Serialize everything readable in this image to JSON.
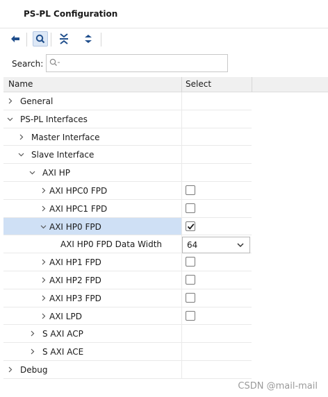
{
  "window": {
    "title": "PS-PL Configuration"
  },
  "toolbar": {
    "buttons": [
      {
        "icon": "back-arrow-icon"
      },
      {
        "icon": "search-icon"
      },
      {
        "icon": "collapse-all-icon"
      },
      {
        "icon": "expand-all-icon"
      }
    ]
  },
  "search": {
    "label": "Search:",
    "placeholder": "",
    "value": ""
  },
  "table": {
    "headers": {
      "name": "Name",
      "select": "Select"
    },
    "rows": [
      {
        "label": "General"
      },
      {
        "label": "PS-PL Interfaces"
      },
      {
        "label": "Master Interface"
      },
      {
        "label": "Slave Interface"
      },
      {
        "label": "AXI HP"
      },
      {
        "label": "AXI HPC0 FPD",
        "checked": false
      },
      {
        "label": "AXI HPC1 FPD",
        "checked": false
      },
      {
        "label": "AXI HP0 FPD",
        "checked": true
      },
      {
        "label": "AXI HP0 FPD Data Width",
        "value": "64"
      },
      {
        "label": "AXI HP1 FPD",
        "checked": false
      },
      {
        "label": "AXI HP2 FPD",
        "checked": false
      },
      {
        "label": "AXI HP3 FPD",
        "checked": false
      },
      {
        "label": "AXI LPD",
        "checked": false
      },
      {
        "label": "S AXI ACP"
      },
      {
        "label": "S AXI ACE"
      },
      {
        "label": "Debug"
      }
    ]
  },
  "watermark": "CSDN @mail-mail",
  "colors": {
    "selected_row": "#cfe0f5",
    "accent": "#1f4e8c"
  }
}
